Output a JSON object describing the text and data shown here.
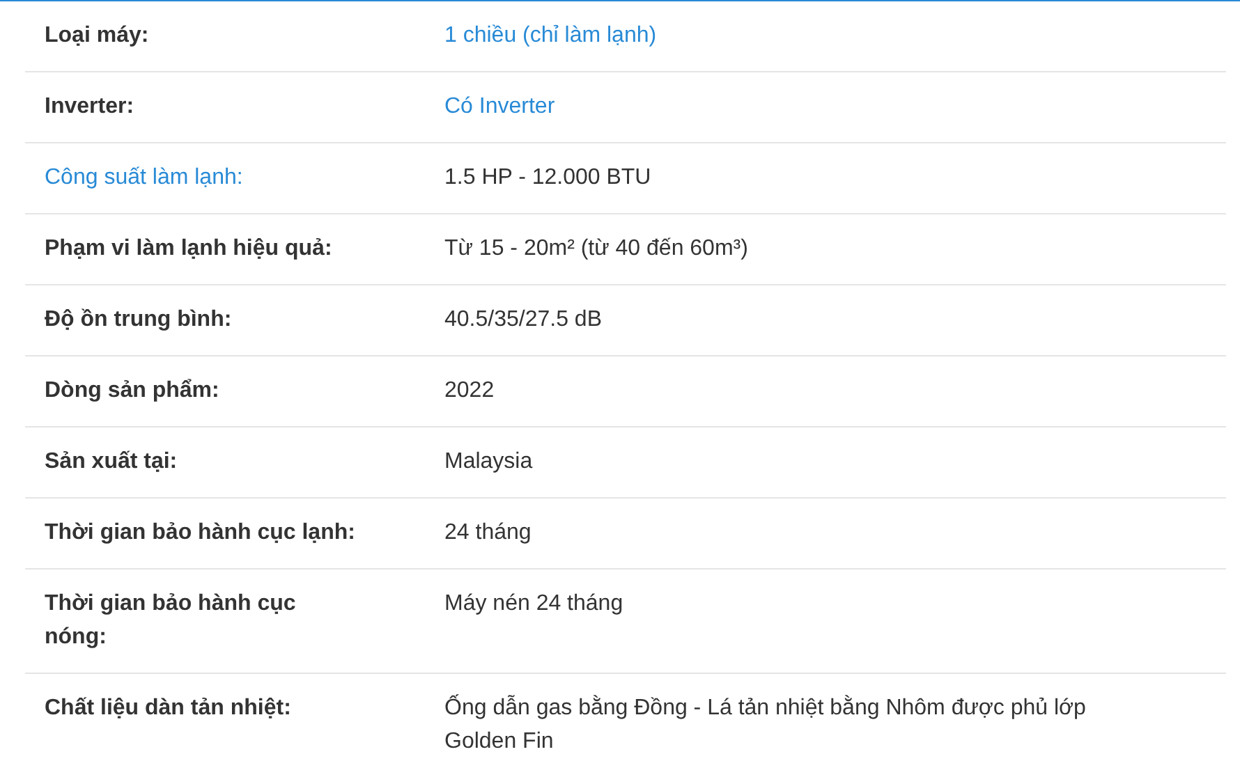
{
  "specs": [
    {
      "label": "Loại máy:",
      "value": "1 chiều (chỉ làm lạnh)",
      "label_link": false,
      "value_link": true
    },
    {
      "label": "Inverter:",
      "value": "Có Inverter",
      "label_link": false,
      "value_link": true
    },
    {
      "label": "Công suất làm lạnh:",
      "value": "1.5 HP - 12.000 BTU",
      "label_link": true,
      "value_link": false
    },
    {
      "label": "Phạm vi làm lạnh hiệu quả:",
      "value": "Từ 15 - 20m² (từ 40 đến 60m³)",
      "label_link": false,
      "value_link": false
    },
    {
      "label": "Độ ồn trung bình:",
      "value": "40.5/35/27.5 dB",
      "label_link": false,
      "value_link": false
    },
    {
      "label": "Dòng sản phẩm:",
      "value": "2022",
      "label_link": false,
      "value_link": false
    },
    {
      "label": "Sản xuất tại:",
      "value": "Malaysia",
      "label_link": false,
      "value_link": false
    },
    {
      "label": "Thời gian bảo hành cục lạnh:",
      "value": "24 tháng",
      "label_link": false,
      "value_link": false
    },
    {
      "label": "Thời gian bảo hành cục nóng:",
      "value": "Máy nén 24 tháng",
      "label_link": false,
      "value_link": false
    },
    {
      "label": "Chất liệu dàn tản nhiệt:",
      "value": "Ống dẫn gas bằng Đồng - Lá tản nhiệt bằng Nhôm được phủ lớp Golden Fin",
      "label_link": false,
      "value_link": false
    }
  ]
}
